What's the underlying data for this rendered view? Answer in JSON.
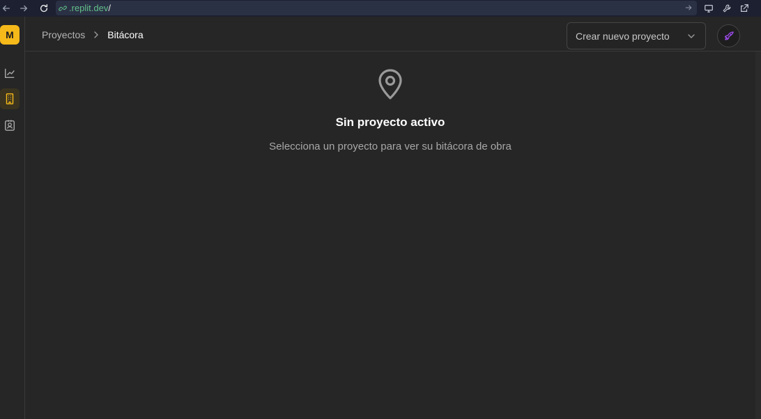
{
  "browser": {
    "url_host": ".replit.dev",
    "url_path": "/"
  },
  "sidebar": {
    "logo_letter": "M",
    "items": [
      {
        "icon": "chart-line-icon",
        "active": false
      },
      {
        "icon": "building-icon",
        "active": true
      },
      {
        "icon": "contact-badge-icon",
        "active": false
      }
    ]
  },
  "header": {
    "breadcrumb": {
      "parent": "Proyectos",
      "current": "Bitácora"
    },
    "project_select": {
      "placeholder": "Crear nuevo proyecto"
    },
    "action_icon": "rocket-icon"
  },
  "empty_state": {
    "icon": "map-pin-icon",
    "title": "Sin proyecto activo",
    "subtitle": "Selecciona un proyecto para ver su bitácora de obra"
  },
  "colors": {
    "background": "#262626",
    "accent_yellow": "#f5b91a",
    "rocket_purple": "#a14cf2",
    "url_green": "#62c08a"
  }
}
